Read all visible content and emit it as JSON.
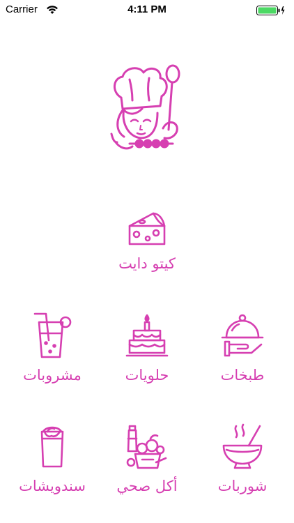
{
  "status_bar": {
    "carrier": "Carrier",
    "time": "4:11 PM",
    "battery_color": "#4cd964"
  },
  "accent_color": "#d63fb1",
  "logo": {
    "icon": "chef-woman-logo"
  },
  "categories": {
    "keto": {
      "label": "كيتو دايت",
      "icon": "cheese-icon"
    },
    "drinks": {
      "label": "مشروبات",
      "icon": "juice-glass-icon"
    },
    "sweets": {
      "label": "حلويات",
      "icon": "birthday-cake-icon"
    },
    "dishes": {
      "label": "طبخات",
      "icon": "serving-dish-icon"
    },
    "sandwiches": {
      "label": "سندويشات",
      "icon": "wrap-sandwich-icon"
    },
    "healthy": {
      "label": "أكل صحي",
      "icon": "groceries-icon"
    },
    "soups": {
      "label": "شوربات",
      "icon": "soup-bowl-icon"
    }
  }
}
